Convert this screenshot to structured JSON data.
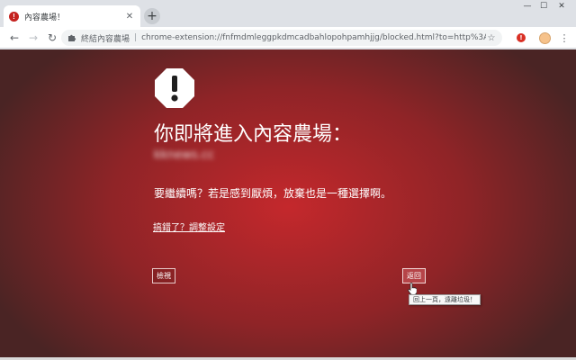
{
  "tab": {
    "favicon": "!",
    "title": "內容農場！",
    "close_glyph": "✕"
  },
  "new_tab_glyph": "+",
  "window_controls": {
    "minimize": "—",
    "maximize": "☐",
    "close": "✕"
  },
  "toolbar": {
    "back_glyph": "←",
    "forward_glyph": "→",
    "reload_glyph": "↻",
    "site_name": "終結內容農場",
    "separator": "|",
    "url": "chrome-extension://fnfmdmleggpkdmcadbahlopohpamhjjg/blocked.html?to=http%3A%2F...",
    "star_glyph": "☆",
    "ext_badge": "!",
    "menu_glyph": "⋮"
  },
  "page": {
    "headline": "你即將進入內容農場：",
    "blocked_domain": "kknews.cc",
    "question": "要繼續嗎？若是感到厭煩，放棄也是一種選擇啊。",
    "settings_link": "搞錯了？調整設定",
    "view_button": "檢視",
    "back_button": "返回",
    "tooltip": "回上一頁，遠離垃圾！"
  },
  "colors": {
    "page_center": "#c4282c",
    "page_edge": "#4a2424",
    "text": "#ffffff"
  }
}
